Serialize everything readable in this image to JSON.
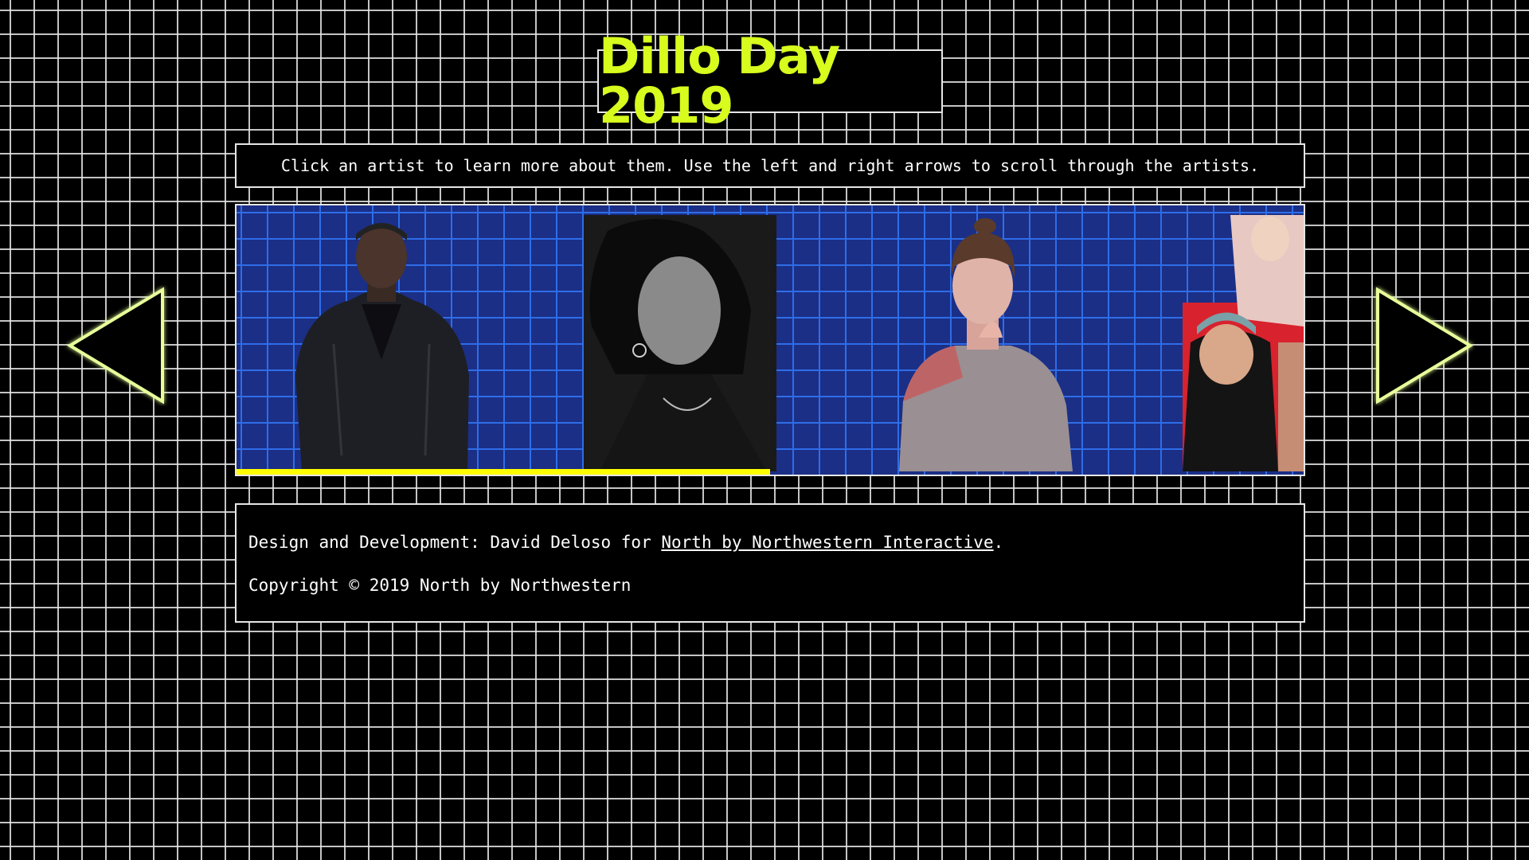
{
  "header": {
    "title": "Dillo Day 2019"
  },
  "instructions": {
    "text": "Click an artist to learn more about them. Use the left and right arrows to scroll through the artists."
  },
  "carousel": {
    "artists": [
      {
        "icon": "artist-photo-1"
      },
      {
        "icon": "artist-photo-2"
      },
      {
        "icon": "artist-photo-3"
      },
      {
        "icon": "artist-photo-4"
      }
    ],
    "progress": 0.5,
    "progress_color": "#ffff00",
    "background_color": "#1b2f86",
    "grid_color": "#2f6de8"
  },
  "navigation": {
    "left_arrow_icon": "triangle-left-icon",
    "right_arrow_icon": "triangle-right-icon",
    "arrow_glow_color": "#e8ff9a"
  },
  "footer": {
    "credit_prefix": "Design and Development: David Deloso for ",
    "credit_link": "North by Northwestern Interactive",
    "credit_suffix": ".",
    "copyright": "Copyright © 2019 North by Northwestern"
  },
  "colors": {
    "accent": "#d7fc1d",
    "background": "#000000",
    "grid": "#e6e6e6"
  }
}
